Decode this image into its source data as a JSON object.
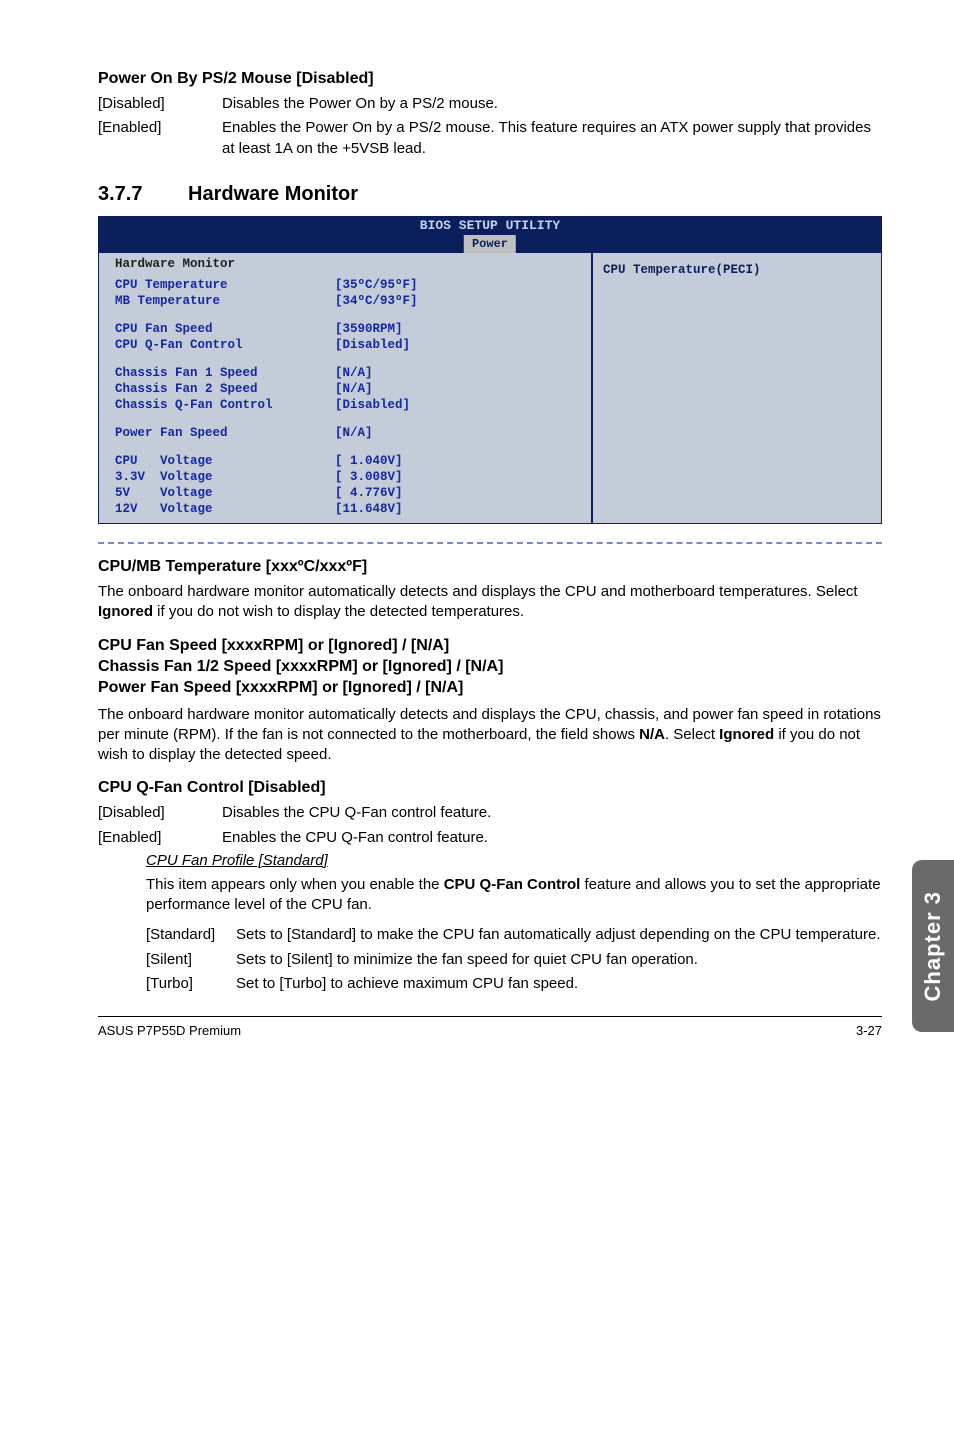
{
  "section1": {
    "title": "Power On By PS/2 Mouse [Disabled]",
    "rows": [
      {
        "opt": "[Disabled]",
        "desc": "Disables the Power On by a PS/2 mouse."
      },
      {
        "opt": "[Enabled]",
        "desc": "Enables the Power On by a PS/2 mouse. This feature requires an ATX power supply that provides at least 1A on the +5VSB lead."
      }
    ]
  },
  "section_hw": {
    "num": "3.7.7",
    "title": "Hardware Monitor"
  },
  "bios": {
    "bar_line1": "BIOS SETUP UTILITY",
    "bar_tab": "Power",
    "panel_title": "Hardware Monitor",
    "right_hint": "CPU Temperature(PECI)",
    "groups": [
      [
        {
          "label": "CPU Temperature",
          "val": "[35ºC/95ºF]"
        },
        {
          "label": "MB Temperature",
          "val": "[34ºC/93ºF]"
        }
      ],
      [
        {
          "label": "CPU Fan Speed",
          "val": "[3590RPM]"
        },
        {
          "label": "CPU Q-Fan Control",
          "val": "[Disabled]"
        }
      ],
      [
        {
          "label": "Chassis Fan 1 Speed",
          "val": "[N/A]"
        },
        {
          "label": "Chassis Fan 2 Speed",
          "val": "[N/A]"
        },
        {
          "label": "Chassis Q-Fan Control",
          "val": "[Disabled]"
        }
      ],
      [
        {
          "label": "Power Fan Speed",
          "val": "[N/A]"
        }
      ],
      [
        {
          "label": "CPU   Voltage",
          "val": "[ 1.040V]"
        },
        {
          "label": "3.3V  Voltage",
          "val": "[ 3.008V]"
        },
        {
          "label": "5V    Voltage",
          "val": "[ 4.776V]"
        },
        {
          "label": "12V   Voltage",
          "val": "[11.648V]"
        }
      ]
    ]
  },
  "cpumb": {
    "title": "CPU/MB Temperature [xxxºC/xxxºF]",
    "body": "The onboard hardware monitor automatically detects and displays the CPU and motherboard temperatures. Select Ignored if you do not wish to display the detected temperatures."
  },
  "fanspeed": {
    "line1": "CPU Fan Speed [xxxxRPM] or [Ignored] / [N/A]",
    "line2": "Chassis Fan 1/2 Speed [xxxxRPM] or [Ignored] / [N/A]",
    "line3": "Power Fan Speed [xxxxRPM] or [Ignored] / [N/A]",
    "body": "The onboard hardware monitor automatically detects and displays the CPU, chassis, and power fan speed in rotations per minute (RPM). If the fan is not connected to the motherboard, the field shows N/A. Select Ignored if you do not wish to display the detected speed."
  },
  "qfan": {
    "title": "CPU Q-Fan Control [Disabled]",
    "rows": [
      {
        "opt": "[Disabled]",
        "desc": "Disables the CPU Q-Fan control feature."
      },
      {
        "opt": "[Enabled]",
        "desc": "Enables the CPU Q-Fan control feature."
      }
    ],
    "profile_head": "CPU Fan Profile [Standard]",
    "profile_intro": "This item appears only when you enable the CPU Q-Fan Control feature and allows you to set the appropriate performance level of the CPU fan.",
    "profile_rows": [
      {
        "opt": "[Standard]",
        "desc": "Sets to [Standard] to make the CPU fan automatically adjust depending on the CPU temperature."
      },
      {
        "opt": "[Silent]",
        "desc": "Sets to [Silent] to minimize the fan speed for quiet CPU fan operation."
      },
      {
        "opt": "[Turbo]",
        "desc": "Set to [Turbo] to achieve maximum CPU fan speed."
      }
    ]
  },
  "chapter_tab": "Chapter 3",
  "footer": {
    "left": "ASUS P7P55D Premium",
    "right": "3-27"
  }
}
